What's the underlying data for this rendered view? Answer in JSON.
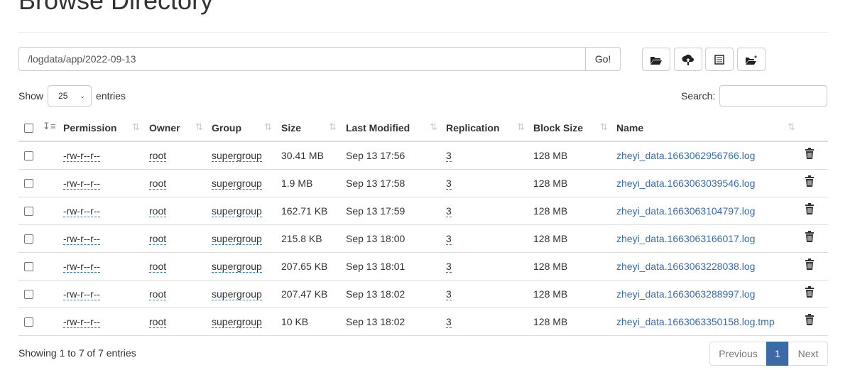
{
  "title": "Browse Directory",
  "path_input": "/logdata/app/2022-09-13",
  "go_label": "Go!",
  "toolbar": [
    {
      "icon": "folder-open-icon"
    },
    {
      "icon": "cloud-upload-icon"
    },
    {
      "icon": "list-alt-icon"
    },
    {
      "icon": "new-folder-icon"
    }
  ],
  "show_label": "Show",
  "entries_label": "entries",
  "page_size": "25",
  "search_label": "Search:",
  "search_value": "",
  "columns": [
    "Permission",
    "Owner",
    "Group",
    "Size",
    "Last Modified",
    "Replication",
    "Block Size",
    "Name"
  ],
  "rows": [
    {
      "permission": "-rw-r--r--",
      "owner": "root",
      "group": "supergroup",
      "size": "30.41 MB",
      "modified": "Sep 13 17:56",
      "replication": "3",
      "block_size": "128 MB",
      "name": "zheyi_data.1663062956766.log"
    },
    {
      "permission": "-rw-r--r--",
      "owner": "root",
      "group": "supergroup",
      "size": "1.9 MB",
      "modified": "Sep 13 17:58",
      "replication": "3",
      "block_size": "128 MB",
      "name": "zheyi_data.1663063039546.log"
    },
    {
      "permission": "-rw-r--r--",
      "owner": "root",
      "group": "supergroup",
      "size": "162.71 KB",
      "modified": "Sep 13 17:59",
      "replication": "3",
      "block_size": "128 MB",
      "name": "zheyi_data.1663063104797.log"
    },
    {
      "permission": "-rw-r--r--",
      "owner": "root",
      "group": "supergroup",
      "size": "215.8 KB",
      "modified": "Sep 13 18:00",
      "replication": "3",
      "block_size": "128 MB",
      "name": "zheyi_data.1663063166017.log"
    },
    {
      "permission": "-rw-r--r--",
      "owner": "root",
      "group": "supergroup",
      "size": "207.65 KB",
      "modified": "Sep 13 18:01",
      "replication": "3",
      "block_size": "128 MB",
      "name": "zheyi_data.1663063228038.log"
    },
    {
      "permission": "-rw-r--r--",
      "owner": "root",
      "group": "supergroup",
      "size": "207.47 KB",
      "modified": "Sep 13 18:02",
      "replication": "3",
      "block_size": "128 MB",
      "name": "zheyi_data.1663063288997.log"
    },
    {
      "permission": "-rw-r--r--",
      "owner": "root",
      "group": "supergroup",
      "size": "10 KB",
      "modified": "Sep 13 18:02",
      "replication": "3",
      "block_size": "128 MB",
      "name": "zheyi_data.1663063350158.log.tmp"
    }
  ],
  "footer_info": "Showing 1 to 7 of 7 entries",
  "pagination": {
    "previous": "Previous",
    "current": "1",
    "next": "Next"
  },
  "colors": {
    "link": "#3a6aa8",
    "active_page": "#3a6aa8"
  }
}
